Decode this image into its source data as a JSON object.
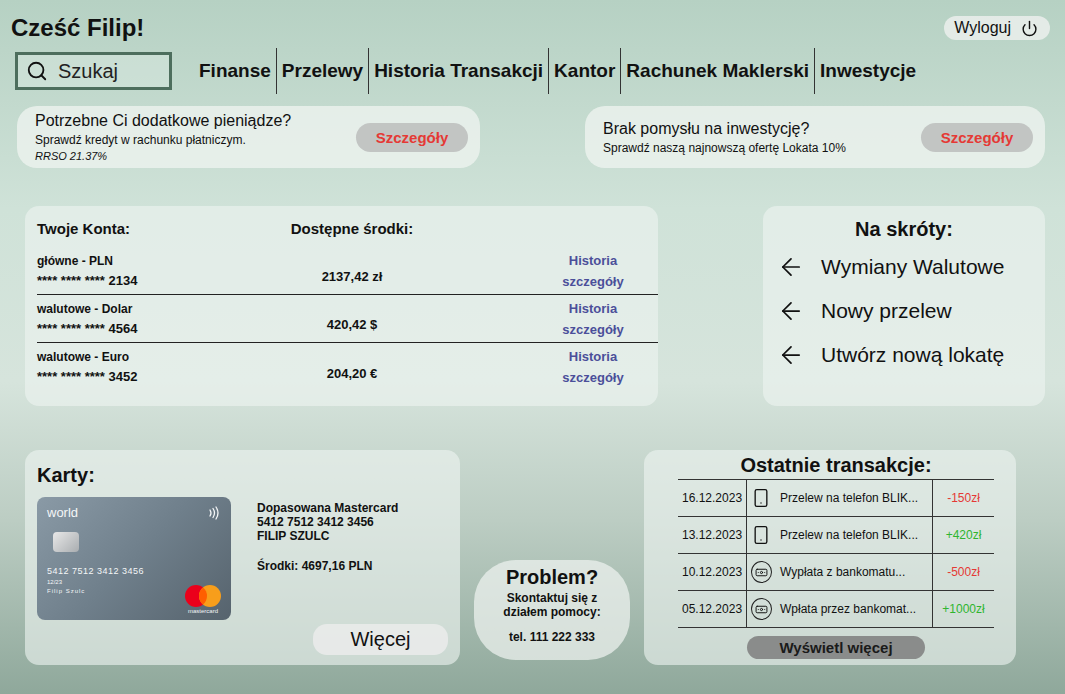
{
  "greeting": "Cześć Filip!",
  "logout": {
    "label": "Wyloguj"
  },
  "search": {
    "placeholder": "Szukaj"
  },
  "nav": [
    {
      "label": "Finanse"
    },
    {
      "label": "Przelewy"
    },
    {
      "label": "Historia Transakcji"
    },
    {
      "label": "Kantor"
    },
    {
      "label": "Rachunek Maklerski"
    },
    {
      "label": "Inwestycje"
    }
  ],
  "promos": [
    {
      "title": "Potrzebne Ci dodatkowe pieniądze?",
      "text": "Sprawdź kredyt w rachunku płatniczym.",
      "note": "RRSO 21.37%",
      "button": "Szczegóły"
    },
    {
      "title": "Brak pomysłu na inwestycję?",
      "text": "Sprawdź naszą najnowszą ofertę Lokata 10%",
      "button": "Szczegóły"
    }
  ],
  "accounts": {
    "title": "Twoje Konta:",
    "balance_header": "Dostępne środki:",
    "rows": [
      {
        "name": "główne - PLN",
        "number": "**** **** **** 2134",
        "balance": "2137,42 zł",
        "history": "Historia",
        "details": "szczegóły"
      },
      {
        "name": "walutowe - Dolar",
        "number": "**** **** **** 4564",
        "balance": "420,42 $",
        "history": "Historia",
        "details": "szczegóły"
      },
      {
        "name": "walutowe - Euro",
        "number": "**** **** **** 3452",
        "balance": "204,20  €",
        "history": "Historia",
        "details": "szczegóły"
      }
    ]
  },
  "shortcuts": {
    "title": "Na skróty:",
    "items": [
      "Wymiany Walutowe",
      "Nowy przelew",
      "Utwórz nową lokatę"
    ]
  },
  "cards": {
    "title": "Karty:",
    "card": {
      "brand": "world",
      "number": "5412 7512 3412 3456",
      "expiry": "12/23",
      "holder": "Filip Szulc",
      "logo": "mastercard"
    },
    "name": "Dopasowana Mastercard",
    "number": "5412 7512 3412 3456",
    "owner": "FILIP SZULC",
    "funds": "Środki: 4697,16 PLN",
    "button": "Więcej"
  },
  "help": {
    "title": "Problem?",
    "text": "Skontaktuj się z działem pomocy:",
    "phone": "tel. 111 222 333"
  },
  "transactions": {
    "title": "Ostatnie transakcje:",
    "rows": [
      {
        "date": "16.12.2023",
        "kind": "blik",
        "description": "Przelew na telefon BLIK...",
        "amount": "-150zł",
        "color": "#e53935"
      },
      {
        "date": "13.12.2023",
        "kind": "blik",
        "description": "Przelew na telefon BLIK...",
        "amount": "+420zł",
        "color": "#2fb52f"
      },
      {
        "date": "10.12.2023",
        "kind": "atm",
        "description": "Wypłata z bankomatu...",
        "amount": "-500zł",
        "color": "#e53935"
      },
      {
        "date": "05.12.2023",
        "kind": "atm",
        "description": "Wpłata przez bankomat...",
        "amount": "+1000zł",
        "color": "#2fb52f"
      }
    ],
    "button": "Wyświetl więcej"
  }
}
